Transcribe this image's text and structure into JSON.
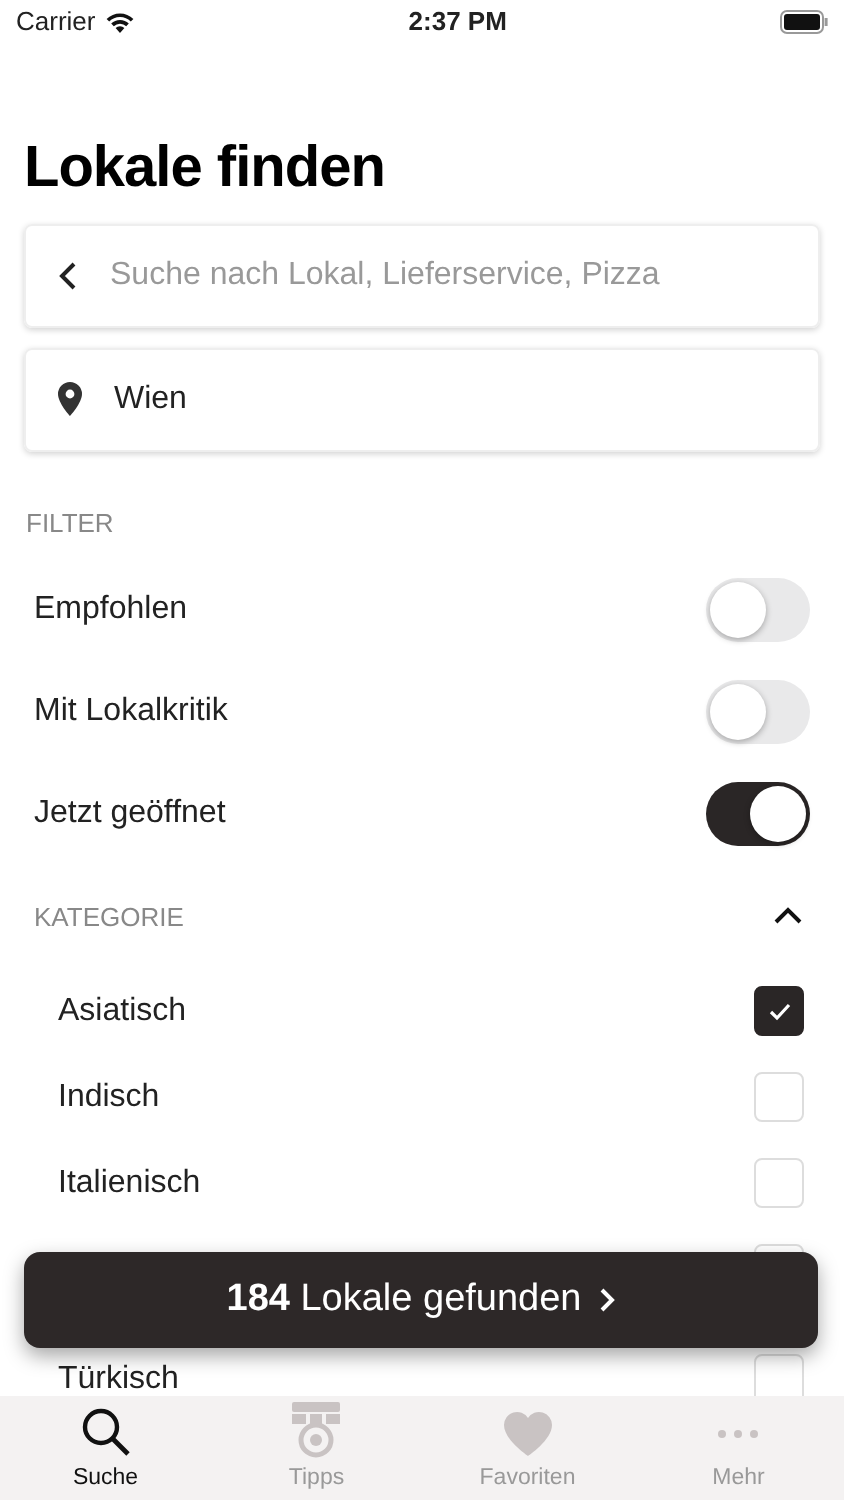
{
  "status_bar": {
    "carrier": "Carrier",
    "time": "2:37 PM"
  },
  "title": "Lokale finden",
  "search": {
    "placeholder": "Suche nach Lokal, Lieferservice, Pizza"
  },
  "location": {
    "value": "Wien"
  },
  "filter": {
    "heading": "FILTER",
    "items": [
      {
        "label": "Empfohlen",
        "on": false
      },
      {
        "label": "Mit Lokalkritik",
        "on": false
      },
      {
        "label": "Jetzt geöffnet",
        "on": true
      }
    ]
  },
  "category": {
    "heading": "KATEGORIE",
    "expanded": true,
    "items": [
      {
        "label": "Asiatisch",
        "checked": true
      },
      {
        "label": "Indisch",
        "checked": false
      },
      {
        "label": "Italienisch",
        "checked": false
      },
      {
        "checked": false
      },
      {
        "label": "Türkisch",
        "checked": false
      }
    ]
  },
  "results_button": {
    "label": "**184** Lokale gefunden"
  },
  "tab_bar": [
    {
      "label": "Suche",
      "kind": "search",
      "selected": true
    },
    {
      "label": "Tipps",
      "kind": "tips",
      "selected": false
    },
    {
      "label": "Favoriten",
      "kind": "heart",
      "selected": false
    },
    {
      "label": "Mehr",
      "kind": "more",
      "selected": false
    }
  ]
}
